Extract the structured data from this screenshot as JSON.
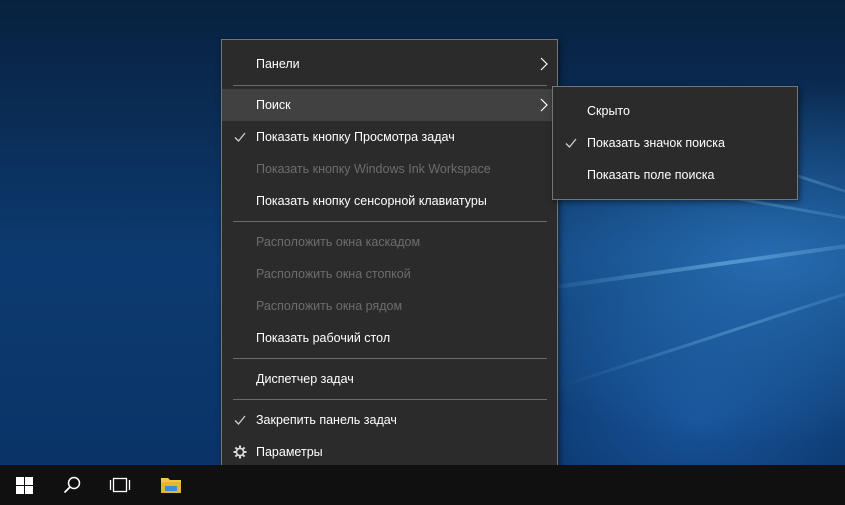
{
  "context_menu": {
    "items": [
      {
        "label": "Панели",
        "state": "enabled",
        "submenu": true
      },
      {
        "label": "Поиск",
        "state": "highlighted",
        "submenu": true
      },
      {
        "label": "Показать кнопку Просмотра задач",
        "state": "enabled",
        "checked": true
      },
      {
        "label": "Показать кнопку Windows Ink Workspace",
        "state": "disabled"
      },
      {
        "label": "Показать кнопку сенсорной клавиатуры",
        "state": "enabled"
      },
      {
        "label": "Расположить окна каскадом",
        "state": "disabled"
      },
      {
        "label": "Расположить окна стопкой",
        "state": "disabled"
      },
      {
        "label": "Расположить окна рядом",
        "state": "disabled"
      },
      {
        "label": "Показать рабочий стол",
        "state": "enabled"
      },
      {
        "label": "Диспетчер задач",
        "state": "enabled"
      },
      {
        "label": "Закрепить панель задач",
        "state": "enabled",
        "checked": true
      },
      {
        "label": "Параметры",
        "state": "enabled",
        "icon": "gear-icon"
      }
    ]
  },
  "search_submenu": {
    "items": [
      {
        "label": "Скрыто",
        "checked": false
      },
      {
        "label": "Показать значок поиска",
        "checked": true
      },
      {
        "label": "Показать поле поиска",
        "checked": false
      }
    ]
  },
  "taskbar": {
    "icons": [
      "windows-start-icon",
      "search-icon",
      "task-view-icon",
      "file-explorer-icon"
    ]
  },
  "colors": {
    "menu_background": "#2b2b2b",
    "menu_border": "#767676",
    "highlight": "#414141",
    "text": "#ffffff",
    "disabled_text": "#6d6d6d",
    "taskbar": "#101010"
  }
}
